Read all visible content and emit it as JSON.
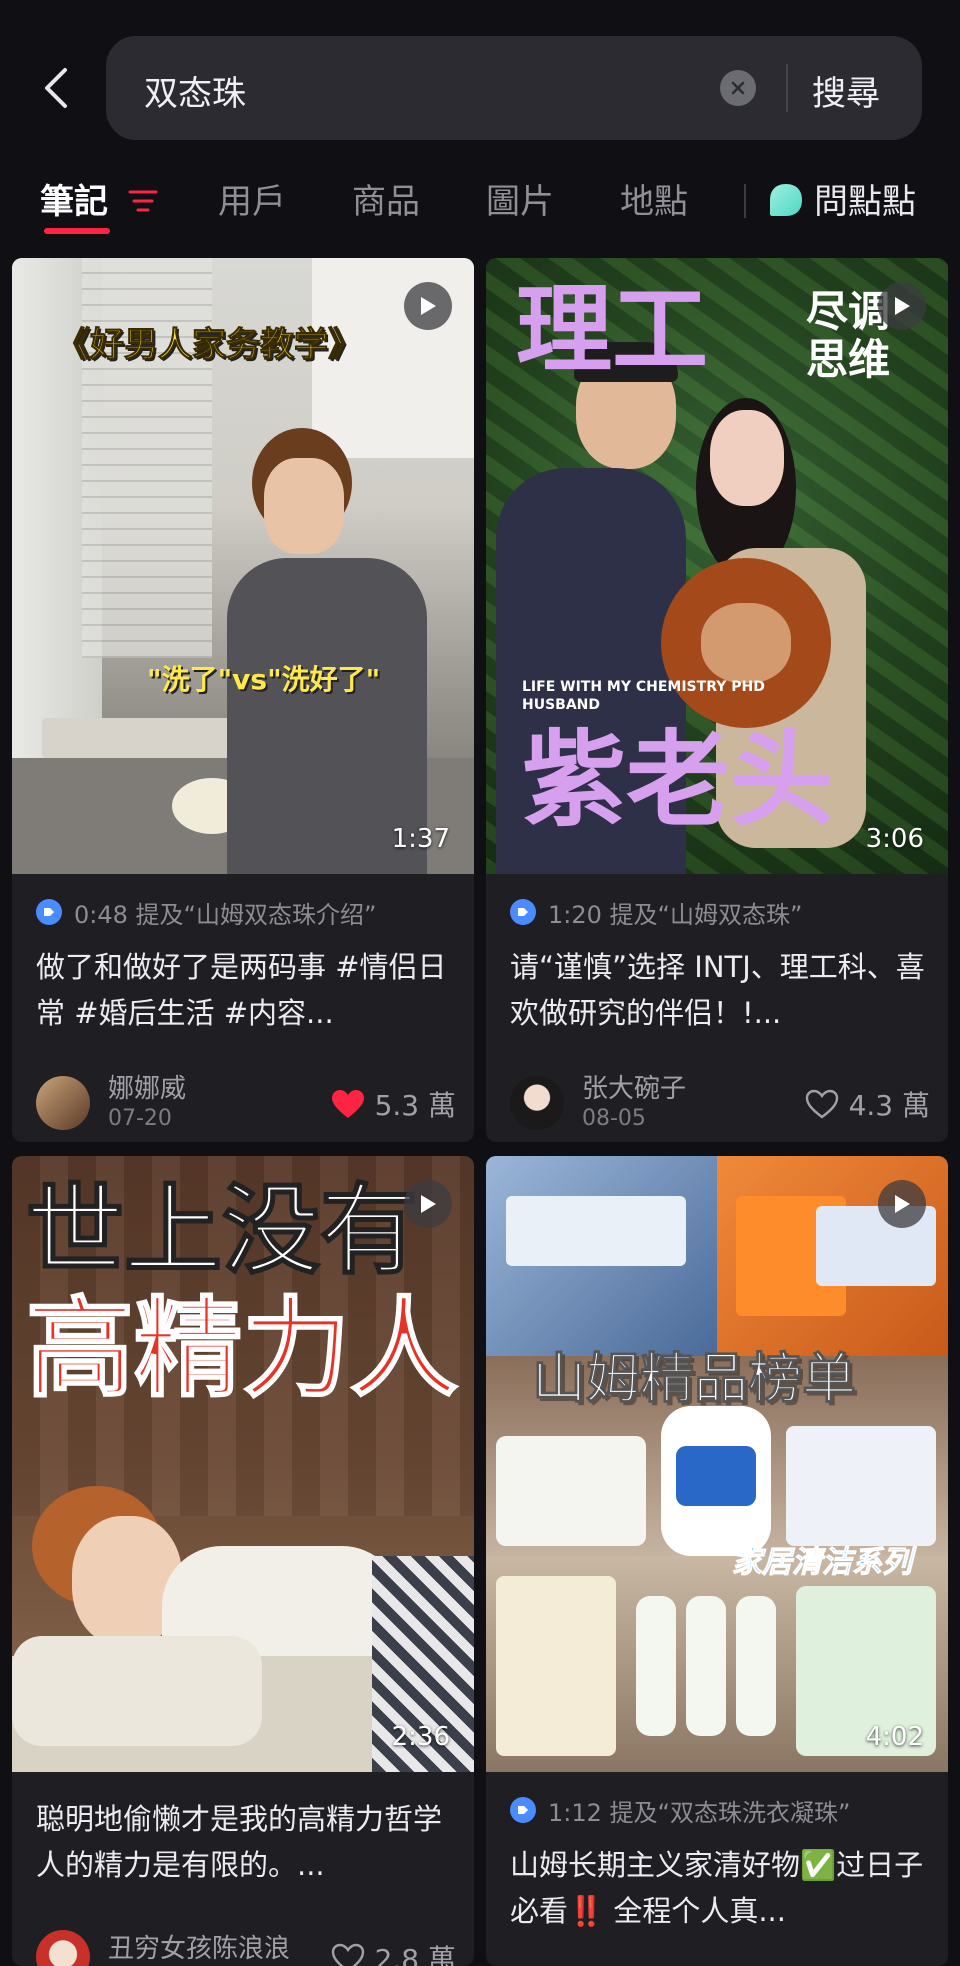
{
  "search": {
    "query": "双态珠",
    "submit_label": "搜尋"
  },
  "tabs": [
    {
      "label": "筆記",
      "active": true
    },
    {
      "label": "用戶"
    },
    {
      "label": "商品"
    },
    {
      "label": "圖片"
    },
    {
      "label": "地點"
    }
  ],
  "ask": {
    "label": "問點點"
  },
  "colors": {
    "accent": "#ff2442",
    "like_red": "#ff2442",
    "mention_blue": "#4a8cff"
  },
  "cards": [
    {
      "thumb_title": "《好男人家务教学》",
      "thumb_sub": "\"洗了\"vs\"洗好了\"",
      "duration": "1:37",
      "mention": "0:48 提及“山姆双态珠介绍”",
      "caption": "做了和做好了是两码事 #情侣日常 #婚后生活 #内容...",
      "author": "娜娜威",
      "date": "07-20",
      "likes": "5.3 萬",
      "liked": true
    },
    {
      "thumb_title_a": "理工",
      "thumb_title_b": "尽调思维",
      "thumb_sub": "LIFE WITH MY CHEMISTRY PHD HUSBAND",
      "thumb_title_c": "紫老头",
      "duration": "3:06",
      "mention": "1:20 提及“山姆双态珠”",
      "caption": "请“谨慎”选择 INTJ、理工科、喜欢做研究的伴侣！!...",
      "author": "张大碗子",
      "date": "08-05",
      "likes": "4.3 萬",
      "liked": false
    },
    {
      "thumb_title_a": "世上没有",
      "thumb_title_b": "高精力人",
      "duration": "2:36",
      "caption": "聪明地偷懒才是我的高精力哲学 人的精力是有限的。...",
      "author": "丑穷女孩陈浪浪",
      "likes": "2.8 萬",
      "liked": false
    },
    {
      "thumb_title": "山姆精品榜单",
      "thumb_sub": "家居清洁系列",
      "duration": "4:02",
      "mention": "1:12 提及“双态珠洗衣凝珠”",
      "caption": "山姆长期主义家清好物✅过日子必看‼️ 全程个人真..."
    }
  ]
}
